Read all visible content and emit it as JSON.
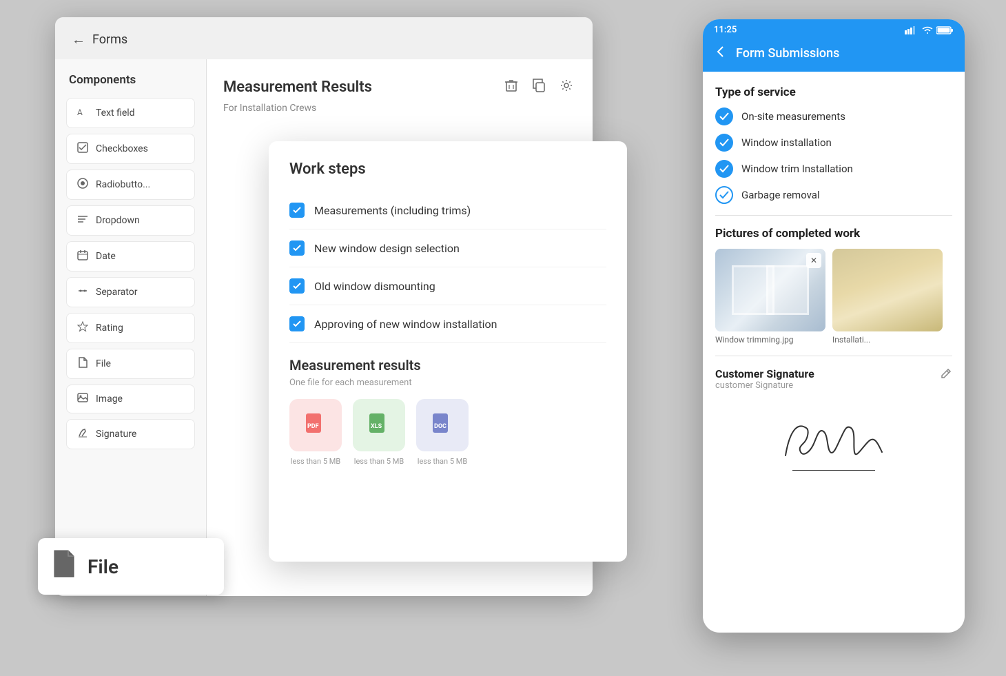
{
  "header": {
    "back_icon": "←",
    "title": "Forms"
  },
  "sidebar": {
    "title": "Components",
    "items": [
      {
        "id": "text-field",
        "label": "Text field",
        "icon": "A"
      },
      {
        "id": "checkboxes",
        "label": "Checkboxes",
        "icon": "☑"
      },
      {
        "id": "radiobutton",
        "label": "Radiobutto...",
        "icon": "◉"
      },
      {
        "id": "dropdown",
        "label": "Dropdown",
        "icon": "≡"
      },
      {
        "id": "date",
        "label": "Date",
        "icon": "📅"
      },
      {
        "id": "separator",
        "label": "Separator",
        "icon": "✂"
      },
      {
        "id": "rating",
        "label": "Rating",
        "icon": "★"
      },
      {
        "id": "file",
        "label": "File",
        "icon": "📄"
      },
      {
        "id": "image",
        "label": "Image",
        "icon": "🖼"
      },
      {
        "id": "signature",
        "label": "Signature",
        "icon": "✏"
      }
    ]
  },
  "form": {
    "title": "Measurement Results",
    "subtitle": "For Installation Crews",
    "actions": {
      "delete_icon": "🗑",
      "copy_icon": "⧉",
      "settings_icon": "⚙"
    }
  },
  "work_steps": {
    "title": "Work steps",
    "items": [
      {
        "label": "Measurements (including trims)",
        "checked": true
      },
      {
        "label": "New window design selection",
        "checked": true
      },
      {
        "label": "Old window dismounting",
        "checked": true
      },
      {
        "label": "Approving of new window installation",
        "checked": true
      }
    ],
    "measurement_section": {
      "title": "Measurement results",
      "subtitle": "One file for each measurement",
      "files": [
        {
          "type": "pdf",
          "label": "less than 5 MB"
        },
        {
          "type": "xls",
          "label": "less than 5 MB"
        },
        {
          "type": "doc",
          "label": "less than 5 MB"
        }
      ]
    }
  },
  "file_drag": {
    "icon": "📄",
    "label": "File"
  },
  "mobile": {
    "status_bar": {
      "time": "11:25",
      "signal": "●●●●",
      "wifi": "wifi",
      "battery": "battery"
    },
    "header": {
      "back_icon": "←",
      "title": "Form Submissions"
    },
    "type_of_service": {
      "title": "Type of service",
      "items": [
        {
          "label": "On-site measurements",
          "checked": "filled"
        },
        {
          "label": "Window installation",
          "checked": "filled"
        },
        {
          "label": "Window trim Installation",
          "checked": "filled"
        },
        {
          "label": "Garbage removal",
          "checked": "outline"
        }
      ]
    },
    "pictures": {
      "title": "Pictures of completed work",
      "items": [
        {
          "caption": "Window trimming.jpg",
          "has_close": true
        },
        {
          "caption": "Installati...",
          "has_close": false
        }
      ]
    },
    "signature": {
      "title": "Customer Signature",
      "subtitle": "customer Signature",
      "edit_icon": "✏"
    }
  }
}
